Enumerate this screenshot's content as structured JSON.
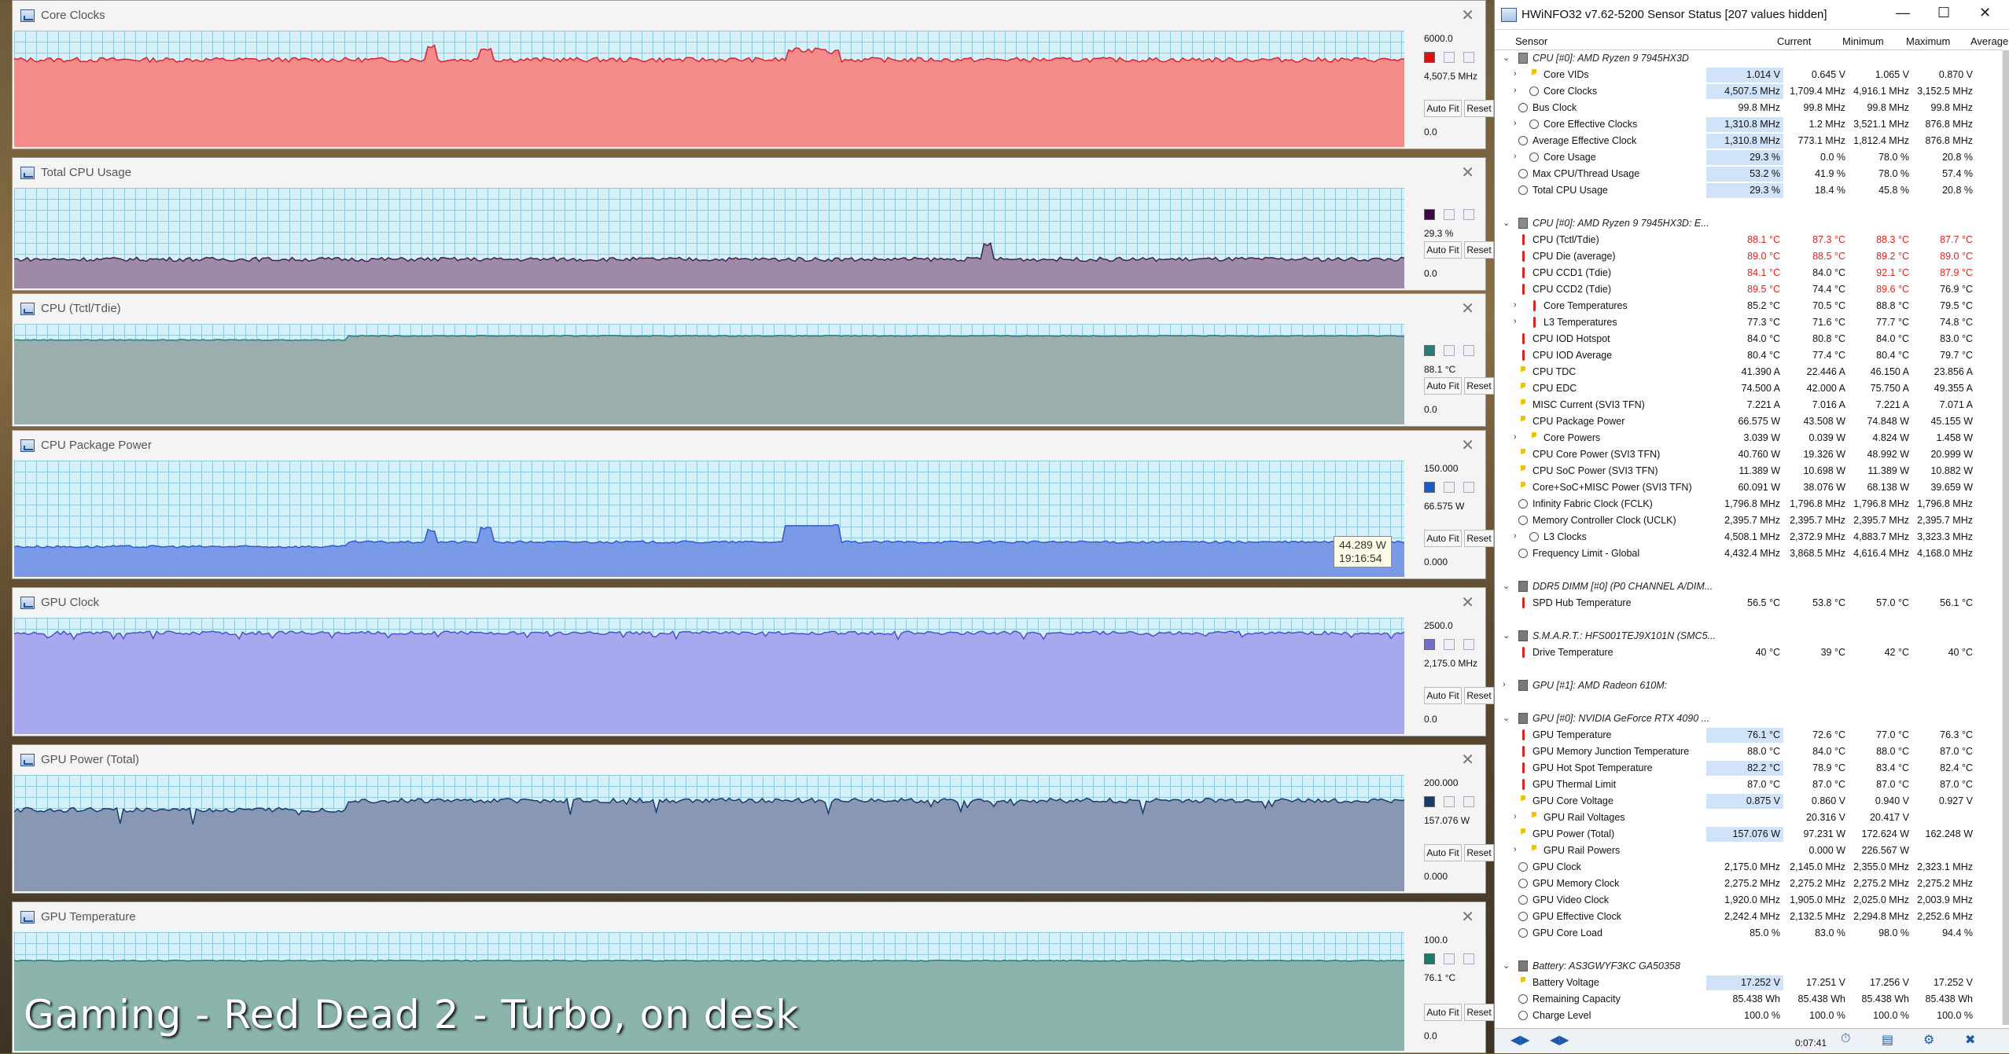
{
  "graphs": [
    {
      "name": "Core Clocks",
      "max": "6000.0",
      "current": "4,507.5 MHz",
      "min": "0.0",
      "color": "#f48b8b",
      "stroke": "#e0202a",
      "swatch": "#dd1111",
      "level": 0.75,
      "noise": 0.02,
      "spikes": [
        [
          0.3,
          0.12
        ],
        [
          0.34,
          0.1
        ],
        [
          0.56,
          0.08
        ],
        [
          0.57,
          0.08
        ],
        [
          0.58,
          0.1
        ],
        [
          0.59,
          0.07
        ]
      ]
    },
    {
      "name": "Total CPU Usage",
      "max": "",
      "current": "29.3 %",
      "min": "0.0",
      "color": "#9e8aa8",
      "stroke": "#402050",
      "swatch": "#3a0a40",
      "level": 0.29,
      "noise": 0.02,
      "spikes": [
        [
          0.7,
          0.15
        ]
      ]
    },
    {
      "name": "CPU (Tctl/Tdie)",
      "max": "",
      "current": "88.1 °C",
      "min": "0.0",
      "color": "#9aaeae",
      "stroke": "#3a7a7a",
      "swatch": "#2a7a7a",
      "level": 0.88,
      "noise": 0.005,
      "spikes": []
    },
    {
      "name": "CPU Package Power",
      "max": "150.000",
      "current": "66.575 W",
      "min": "0.000",
      "color": "#7a9ae8",
      "stroke": "#2f5bd0",
      "swatch": "#1f5bbf",
      "level": 0.3,
      "noise": 0.01,
      "spikes": [
        [
          0.3,
          0.1
        ],
        [
          0.34,
          0.12
        ],
        [
          0.57,
          0.14
        ],
        [
          0.58,
          0.14
        ],
        [
          0.59,
          0.14
        ]
      ]
    },
    {
      "name": "GPU Clock",
      "max": "2500.0",
      "current": "2,175.0 MHz",
      "min": "0.0",
      "color": "#a8a8ee",
      "stroke": "#5050c8",
      "swatch": "#7070c8",
      "level": 0.87,
      "noise": 0.015,
      "spikes": []
    },
    {
      "name": "GPU Power (Total)",
      "max": "200.000",
      "current": "157.076 W",
      "min": "0.000",
      "color": "#8898b4",
      "stroke": "#1a3a6a",
      "swatch": "#1a3a6a",
      "level": 0.78,
      "noise": 0.02,
      "spikes": []
    },
    {
      "name": "GPU Temperature",
      "max": "100.0",
      "current": "76.1 °C",
      "min": "0.0",
      "color": "#8ab4ac",
      "stroke": "#2a7a6a",
      "swatch": "#1a7a6a",
      "level": 0.76,
      "noise": 0.004,
      "spikes": []
    }
  ],
  "buttons": {
    "autofit": "Auto Fit",
    "reset": "Reset"
  },
  "tooltip": {
    "value": "44.289 W",
    "time": "19:16:54"
  },
  "caption": "Gaming - Red Dead 2 - Turbo, on desk",
  "hwinfo": {
    "title": "HWiNFO32 v7.62-5200 Sensor Status [207 values hidden]",
    "columns": [
      "Sensor",
      "Current",
      "Minimum",
      "Maximum",
      "Average"
    ],
    "elapsed": "0:07:41",
    "rows": [
      {
        "t": "g",
        "icon": "cpu",
        "n": "CPU [#0]: AMD Ryzen 9 7945HX3D",
        "tw": "v"
      },
      {
        "icon": "volt",
        "n": "Core VIDs",
        "tw": ">",
        "c": [
          "1.014 V",
          "0.645 V",
          "1.065 V",
          "0.870 V"
        ],
        "sel": 1
      },
      {
        "icon": "clk",
        "n": "Core Clocks",
        "tw": ">",
        "c": [
          "4,507.5 MHz",
          "1,709.4 MHz",
          "4,916.1 MHz",
          "3,152.5 MHz"
        ],
        "sel": 1
      },
      {
        "icon": "clk",
        "n": "Bus Clock",
        "c": [
          "99.8 MHz",
          "99.8 MHz",
          "99.8 MHz",
          "99.8 MHz"
        ]
      },
      {
        "icon": "clk",
        "n": "Core Effective Clocks",
        "tw": ">",
        "c": [
          "1,310.8 MHz",
          "1.2 MHz",
          "3,521.1 MHz",
          "876.8 MHz"
        ],
        "sel": 1
      },
      {
        "icon": "clk",
        "n": "Average Effective Clock",
        "c": [
          "1,310.8 MHz",
          "773.1 MHz",
          "1,812.4 MHz",
          "876.8 MHz"
        ],
        "sel": 1
      },
      {
        "icon": "clk",
        "n": "Core Usage",
        "tw": ">",
        "c": [
          "29.3 %",
          "0.0 %",
          "78.0 %",
          "20.8 %"
        ],
        "sel": 1
      },
      {
        "icon": "clk",
        "n": "Max CPU/Thread Usage",
        "c": [
          "53.2 %",
          "41.9 %",
          "78.0 %",
          "57.4 %"
        ],
        "sel": 1
      },
      {
        "icon": "clk",
        "n": "Total CPU Usage",
        "c": [
          "29.3 %",
          "18.4 %",
          "45.8 %",
          "20.8 %"
        ],
        "sel": 1
      },
      {
        "t": "s"
      },
      {
        "t": "g",
        "icon": "cpu",
        "n": "CPU [#0]: AMD Ryzen 9 7945HX3D: E...",
        "tw": "v"
      },
      {
        "icon": "temp",
        "n": "CPU (Tctl/Tdie)",
        "c": [
          "88.1 °C",
          "87.3 °C",
          "88.3 °C",
          "87.7 °C"
        ],
        "red": [
          0,
          1,
          2,
          3
        ]
      },
      {
        "icon": "temp",
        "n": "CPU Die (average)",
        "c": [
          "89.0 °C",
          "88.5 °C",
          "89.2 °C",
          "89.0 °C"
        ],
        "red": [
          0,
          1,
          2,
          3
        ]
      },
      {
        "icon": "temp",
        "n": "CPU CCD1 (Tdie)",
        "c": [
          "84.1 °C",
          "84.0 °C",
          "92.1 °C",
          "87.9 °C"
        ],
        "red": [
          0,
          2,
          3
        ]
      },
      {
        "icon": "temp",
        "n": "CPU CCD2 (Tdie)",
        "c": [
          "89.5 °C",
          "74.4 °C",
          "89.6 °C",
          "76.9 °C"
        ],
        "red": [
          0,
          2
        ]
      },
      {
        "icon": "temp",
        "n": "Core Temperatures",
        "tw": ">",
        "c": [
          "85.2 °C",
          "70.5 °C",
          "88.8 °C",
          "79.5 °C"
        ]
      },
      {
        "icon": "temp",
        "n": "L3 Temperatures",
        "tw": ">",
        "c": [
          "77.3 °C",
          "71.6 °C",
          "77.7 °C",
          "74.8 °C"
        ]
      },
      {
        "icon": "temp",
        "n": "CPU IOD Hotspot",
        "c": [
          "84.0 °C",
          "80.8 °C",
          "84.0 °C",
          "83.0 °C"
        ]
      },
      {
        "icon": "temp",
        "n": "CPU IOD Average",
        "c": [
          "80.4 °C",
          "77.4 °C",
          "80.4 °C",
          "79.7 °C"
        ]
      },
      {
        "icon": "amp",
        "n": "CPU TDC",
        "c": [
          "41.390 A",
          "22.446 A",
          "46.150 A",
          "23.856 A"
        ]
      },
      {
        "icon": "amp",
        "n": "CPU EDC",
        "c": [
          "74.500 A",
          "42.000 A",
          "75.750 A",
          "49.355 A"
        ]
      },
      {
        "icon": "amp",
        "n": "MISC Current (SVI3 TFN)",
        "c": [
          "7.221 A",
          "7.016 A",
          "7.221 A",
          "7.071 A"
        ]
      },
      {
        "icon": "pwr",
        "n": "CPU Package Power",
        "c": [
          "66.575 W",
          "43.508 W",
          "74.848 W",
          "45.155 W"
        ]
      },
      {
        "icon": "pwr",
        "n": "Core Powers",
        "tw": ">",
        "c": [
          "3.039 W",
          "0.039 W",
          "4.824 W",
          "1.458 W"
        ]
      },
      {
        "icon": "pwr",
        "n": "CPU Core Power (SVI3 TFN)",
        "c": [
          "40.760 W",
          "19.326 W",
          "48.992 W",
          "20.999 W"
        ]
      },
      {
        "icon": "pwr",
        "n": "CPU SoC Power (SVI3 TFN)",
        "c": [
          "11.389 W",
          "10.698 W",
          "11.389 W",
          "10.882 W"
        ]
      },
      {
        "icon": "pwr",
        "n": "Core+SoC+MISC Power (SVI3 TFN)",
        "c": [
          "60.091 W",
          "38.076 W",
          "68.138 W",
          "39.659 W"
        ]
      },
      {
        "icon": "clk",
        "n": "Infinity Fabric Clock (FCLK)",
        "c": [
          "1,796.8 MHz",
          "1,796.8 MHz",
          "1,796.8 MHz",
          "1,796.8 MHz"
        ]
      },
      {
        "icon": "clk",
        "n": "Memory Controller Clock (UCLK)",
        "c": [
          "2,395.7 MHz",
          "2,395.7 MHz",
          "2,395.7 MHz",
          "2,395.7 MHz"
        ]
      },
      {
        "icon": "clk",
        "n": "L3 Clocks",
        "tw": ">",
        "c": [
          "4,508.1 MHz",
          "2,372.9 MHz",
          "4,883.7 MHz",
          "3,323.3 MHz"
        ]
      },
      {
        "icon": "clk",
        "n": "Frequency Limit - Global",
        "c": [
          "4,432.4 MHz",
          "3,868.5 MHz",
          "4,616.4 MHz",
          "4,168.0 MHz"
        ]
      },
      {
        "t": "s"
      },
      {
        "t": "g",
        "icon": "dimm",
        "n": "DDR5 DIMM [#0] (P0 CHANNEL A/DIM...",
        "tw": "v"
      },
      {
        "icon": "temp",
        "n": "SPD Hub Temperature",
        "c": [
          "56.5 °C",
          "53.8 °C",
          "57.0 °C",
          "56.1 °C"
        ]
      },
      {
        "t": "s"
      },
      {
        "t": "g",
        "icon": "disk",
        "n": "S.M.A.R.T.: HFS001TEJ9X101N (SMC5...",
        "tw": "v"
      },
      {
        "icon": "temp",
        "n": "Drive Temperature",
        "c": [
          "40 °C",
          "39 °C",
          "42 °C",
          "40 °C"
        ]
      },
      {
        "t": "s"
      },
      {
        "t": "g",
        "icon": "gpu",
        "n": "GPU [#1]: AMD Radeon 610M:",
        "tw": ">"
      },
      {
        "t": "s"
      },
      {
        "t": "g",
        "icon": "gpu",
        "n": "GPU [#0]: NVIDIA GeForce RTX 4090 ...",
        "tw": "v"
      },
      {
        "icon": "temp",
        "n": "GPU Temperature",
        "c": [
          "76.1 °C",
          "72.6 °C",
          "77.0 °C",
          "76.3 °C"
        ],
        "sel": 1
      },
      {
        "icon": "temp",
        "n": "GPU Memory Junction Temperature",
        "c": [
          "88.0 °C",
          "84.0 °C",
          "88.0 °C",
          "87.0 °C"
        ]
      },
      {
        "icon": "temp",
        "n": "GPU Hot Spot Temperature",
        "c": [
          "82.2 °C",
          "78.9 °C",
          "83.4 °C",
          "82.4 °C"
        ],
        "sel": 1
      },
      {
        "icon": "temp",
        "n": "GPU Thermal Limit",
        "c": [
          "87.0 °C",
          "87.0 °C",
          "87.0 °C",
          "87.0 °C"
        ]
      },
      {
        "icon": "volt",
        "n": "GPU Core Voltage",
        "c": [
          "0.875 V",
          "0.860 V",
          "0.940 V",
          "0.927 V"
        ],
        "sel": 1
      },
      {
        "icon": "volt",
        "n": "GPU Rail Voltages",
        "tw": ">",
        "c": [
          "",
          "20.316 V",
          "20.417 V",
          ""
        ]
      },
      {
        "icon": "pwr",
        "n": "GPU Power (Total)",
        "c": [
          "157.076 W",
          "97.231 W",
          "172.624 W",
          "162.248 W"
        ],
        "sel": 1
      },
      {
        "icon": "pwr",
        "n": "GPU Rail Powers",
        "tw": ">",
        "c": [
          "",
          "0.000 W",
          "226.567 W",
          ""
        ]
      },
      {
        "icon": "clk",
        "n": "GPU Clock",
        "c": [
          "2,175.0 MHz",
          "2,145.0 MHz",
          "2,355.0 MHz",
          "2,323.1 MHz"
        ]
      },
      {
        "icon": "clk",
        "n": "GPU Memory Clock",
        "c": [
          "2,275.2 MHz",
          "2,275.2 MHz",
          "2,275.2 MHz",
          "2,275.2 MHz"
        ]
      },
      {
        "icon": "clk",
        "n": "GPU Video Clock",
        "c": [
          "1,920.0 MHz",
          "1,905.0 MHz",
          "2,025.0 MHz",
          "2,003.9 MHz"
        ]
      },
      {
        "icon": "clk",
        "n": "GPU Effective Clock",
        "c": [
          "2,242.4 MHz",
          "2,132.5 MHz",
          "2,294.8 MHz",
          "2,252.6 MHz"
        ]
      },
      {
        "icon": "clk",
        "n": "GPU Core Load",
        "c": [
          "85.0 %",
          "83.0 %",
          "98.0 %",
          "94.4 %"
        ]
      },
      {
        "t": "s"
      },
      {
        "t": "g",
        "icon": "bat",
        "n": "Battery: AS3GWYF3KC GA50358",
        "tw": "v"
      },
      {
        "icon": "volt",
        "n": "Battery Voltage",
        "c": [
          "17.252 V",
          "17.251 V",
          "17.256 V",
          "17.252 V"
        ],
        "sel": 1
      },
      {
        "icon": "clk",
        "n": "Remaining Capacity",
        "c": [
          "85.438 Wh",
          "85.438 Wh",
          "85.438 Wh",
          "85.438 Wh"
        ]
      },
      {
        "icon": "clk",
        "n": "Charge Level",
        "c": [
          "100.0 %",
          "100.0 %",
          "100.0 %",
          "100.0 %"
        ]
      }
    ]
  }
}
